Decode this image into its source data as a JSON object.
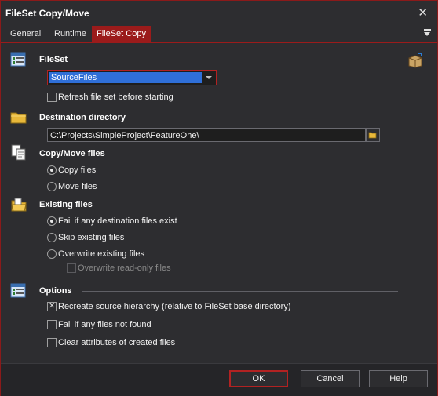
{
  "window": {
    "title": "FileSet Copy/Move"
  },
  "tabs": [
    {
      "label": "General"
    },
    {
      "label": "Runtime"
    },
    {
      "label": "FileSet Copy",
      "active": true
    }
  ],
  "fileset": {
    "title": "FileSet",
    "selected": "SourceFiles",
    "refresh_label": "Refresh file set before starting",
    "refresh_checked": false
  },
  "destination": {
    "title": "Destination directory",
    "path": "C:\\Projects\\SimpleProject\\FeatureOne\\"
  },
  "copymove": {
    "title": "Copy/Move files",
    "options": [
      {
        "label": "Copy files",
        "selected": true
      },
      {
        "label": "Move files",
        "selected": false
      }
    ]
  },
  "existing": {
    "title": "Existing files",
    "options": [
      {
        "label": "Fail if any destination files exist",
        "selected": true
      },
      {
        "label": "Skip existing files",
        "selected": false
      },
      {
        "label": "Overwrite existing files",
        "selected": false
      }
    ],
    "overwrite_readonly_label": "Overwrite read-only files",
    "overwrite_readonly_checked": false
  },
  "options": {
    "title": "Options",
    "items": [
      {
        "label": "Recreate source hierarchy (relative to FileSet base directory)",
        "checked": true
      },
      {
        "label": "Fail if any files not found",
        "checked": false
      },
      {
        "label": "Clear attributes of created files",
        "checked": false
      }
    ]
  },
  "buttons": {
    "ok": "OK",
    "cancel": "Cancel",
    "help": "Help"
  },
  "colors": {
    "accent": "#9b1b1b",
    "selection": "#2f6fd8",
    "background": "#2d2d30"
  }
}
